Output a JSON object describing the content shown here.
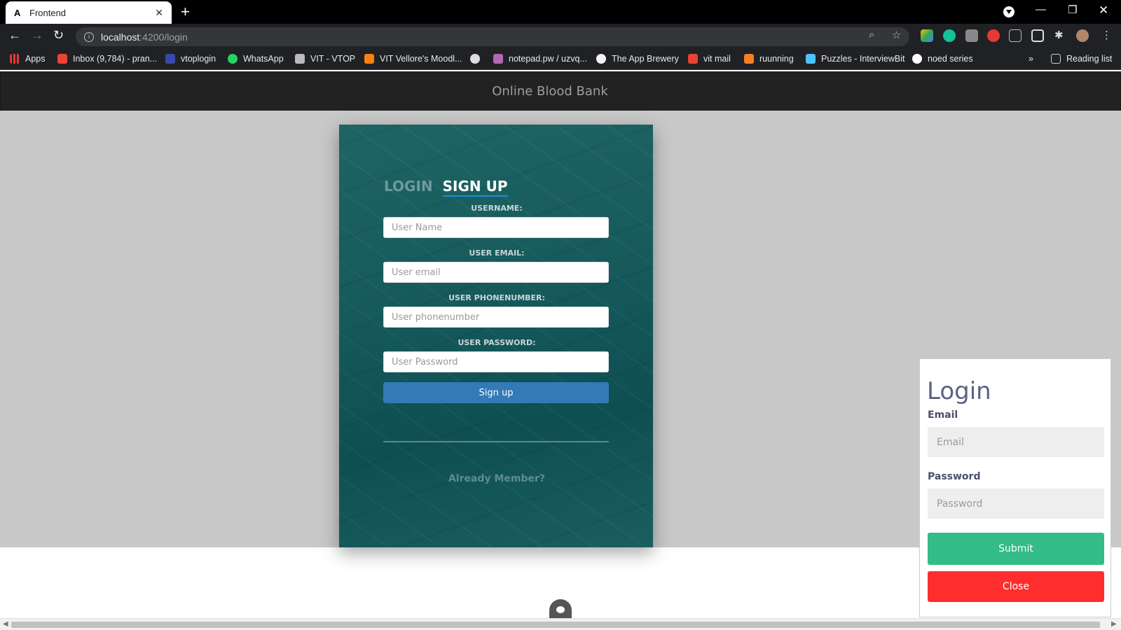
{
  "browser": {
    "tab_title": "Frontend",
    "tab_favicon": "A",
    "url_host": "localhost",
    "url_path": ":4200/login",
    "bookmarks": [
      {
        "label": "Apps",
        "icon": "apps-grid-icon",
        "color": "#e53935"
      },
      {
        "label": "Inbox (9,784) - pran...",
        "icon": "gmail-icon",
        "color": "#ea4335"
      },
      {
        "label": "vtoplogin",
        "icon": "vtop-icon",
        "color": "#3949ab"
      },
      {
        "label": "WhatsApp",
        "icon": "whatsapp-icon",
        "color": "#25d366"
      },
      {
        "label": "VIT - VTOP",
        "icon": "page-icon",
        "color": "#bbbbbb"
      },
      {
        "label": "VIT Vellore's Moodl...",
        "icon": "moodle-icon",
        "color": "#f98012"
      },
      {
        "label": "",
        "icon": "globe-icon",
        "color": "#dddddd"
      },
      {
        "label": "notepad.pw / uzvq...",
        "icon": "notepad-icon",
        "color": "#b06ab3"
      },
      {
        "label": "The App Brewery",
        "icon": "brewery-icon",
        "color": "#f5f5f5"
      },
      {
        "label": "vit mail",
        "icon": "gmail-icon",
        "color": "#ea4335"
      },
      {
        "label": "ruunning",
        "icon": "stack-icon",
        "color": "#f48024"
      },
      {
        "label": "Puzzles - InterviewBit",
        "icon": "interviewbit-icon",
        "color": "#4fc3f7"
      },
      {
        "label": "noed series",
        "icon": "github-icon",
        "color": "#ffffff"
      }
    ],
    "overflow_label": "»",
    "reading_list": "Reading list"
  },
  "header": {
    "title": "Online Blood Bank"
  },
  "signup_card": {
    "tab_login": "LOGIN",
    "tab_signup": "SIGN UP",
    "fields": [
      {
        "label": "USERNAME:",
        "placeholder": "User Name"
      },
      {
        "label": "USER EMAIL:",
        "placeholder": "User email"
      },
      {
        "label": "USER PHONENUMBER:",
        "placeholder": "User phonenumber"
      },
      {
        "label": "USER PASSWORD:",
        "placeholder": "User Password"
      }
    ],
    "submit_label": "Sign up",
    "already_member": "Already Member?"
  },
  "login_panel": {
    "title": "Login",
    "email_label": "Email",
    "email_placeholder": "Email",
    "password_label": "Password",
    "password_placeholder": "Password",
    "submit_label": "Submit",
    "close_label": "Close",
    "submit_color": "#33bb88",
    "close_color": "#ff2d2d"
  }
}
